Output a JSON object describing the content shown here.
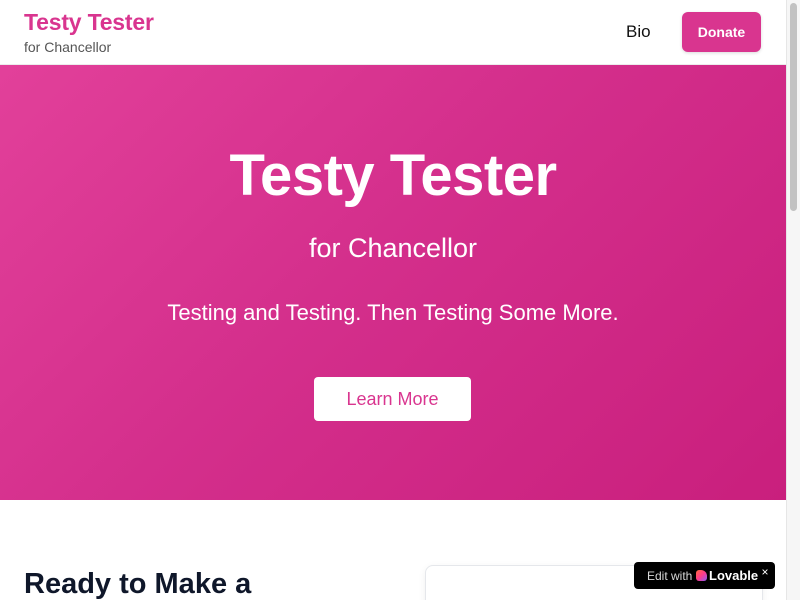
{
  "header": {
    "brand_title": "Testy Tester",
    "brand_subtitle": "for Chancellor",
    "nav_bio": "Bio",
    "donate_label": "Donate"
  },
  "hero": {
    "title": "Testy Tester",
    "subtitle": "for Chancellor",
    "tagline": "Testing and Testing. Then Testing Some More.",
    "cta_label": "Learn More"
  },
  "section": {
    "heading": "Ready to Make a"
  },
  "badge": {
    "prefix": "Edit with",
    "brand": "Lovable",
    "close": "×"
  },
  "colors": {
    "brand": "#d9358f",
    "hero_gradient_start": "#e2409a",
    "hero_gradient_end": "#c91f7d",
    "heading": "#0f172a"
  },
  "icons": [
    "lovable-heart-icon",
    "close-icon"
  ]
}
